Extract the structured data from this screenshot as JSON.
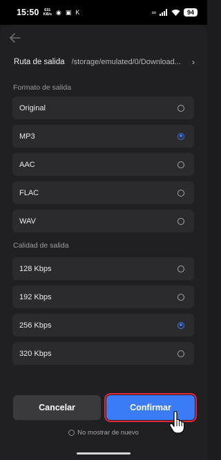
{
  "status_bar": {
    "time": "15:50",
    "net_speed_value": "631",
    "net_speed_unit": "KB/s",
    "battery": "94"
  },
  "header": {
    "back_icon": "arrow-left-icon"
  },
  "output_path": {
    "label": "Ruta de salida",
    "value": "/storage/emulated/0/Download...",
    "chevron": "›"
  },
  "format": {
    "title": "Formato de salida",
    "options": [
      {
        "label": "Original",
        "selected": false
      },
      {
        "label": "MP3",
        "selected": true
      },
      {
        "label": "AAC",
        "selected": false
      },
      {
        "label": "FLAC",
        "selected": false
      },
      {
        "label": "WAV",
        "selected": false
      }
    ]
  },
  "quality": {
    "title": "Calidad de salida",
    "options": [
      {
        "label": "128 Kbps",
        "selected": false
      },
      {
        "label": "192 Kbps",
        "selected": false
      },
      {
        "label": "256 Kbps",
        "selected": true
      },
      {
        "label": "320 Kbps",
        "selected": false
      }
    ]
  },
  "actions": {
    "cancel_label": "Cancelar",
    "confirm_label": "Confirmar"
  },
  "dont_show": {
    "label": "No mostrar de nuevo",
    "checked": false
  },
  "colors": {
    "accent": "#3b7cf6",
    "highlight_outline": "#e8283a",
    "background": "#1c1c1e",
    "option_bg": "#2b2b2e"
  }
}
